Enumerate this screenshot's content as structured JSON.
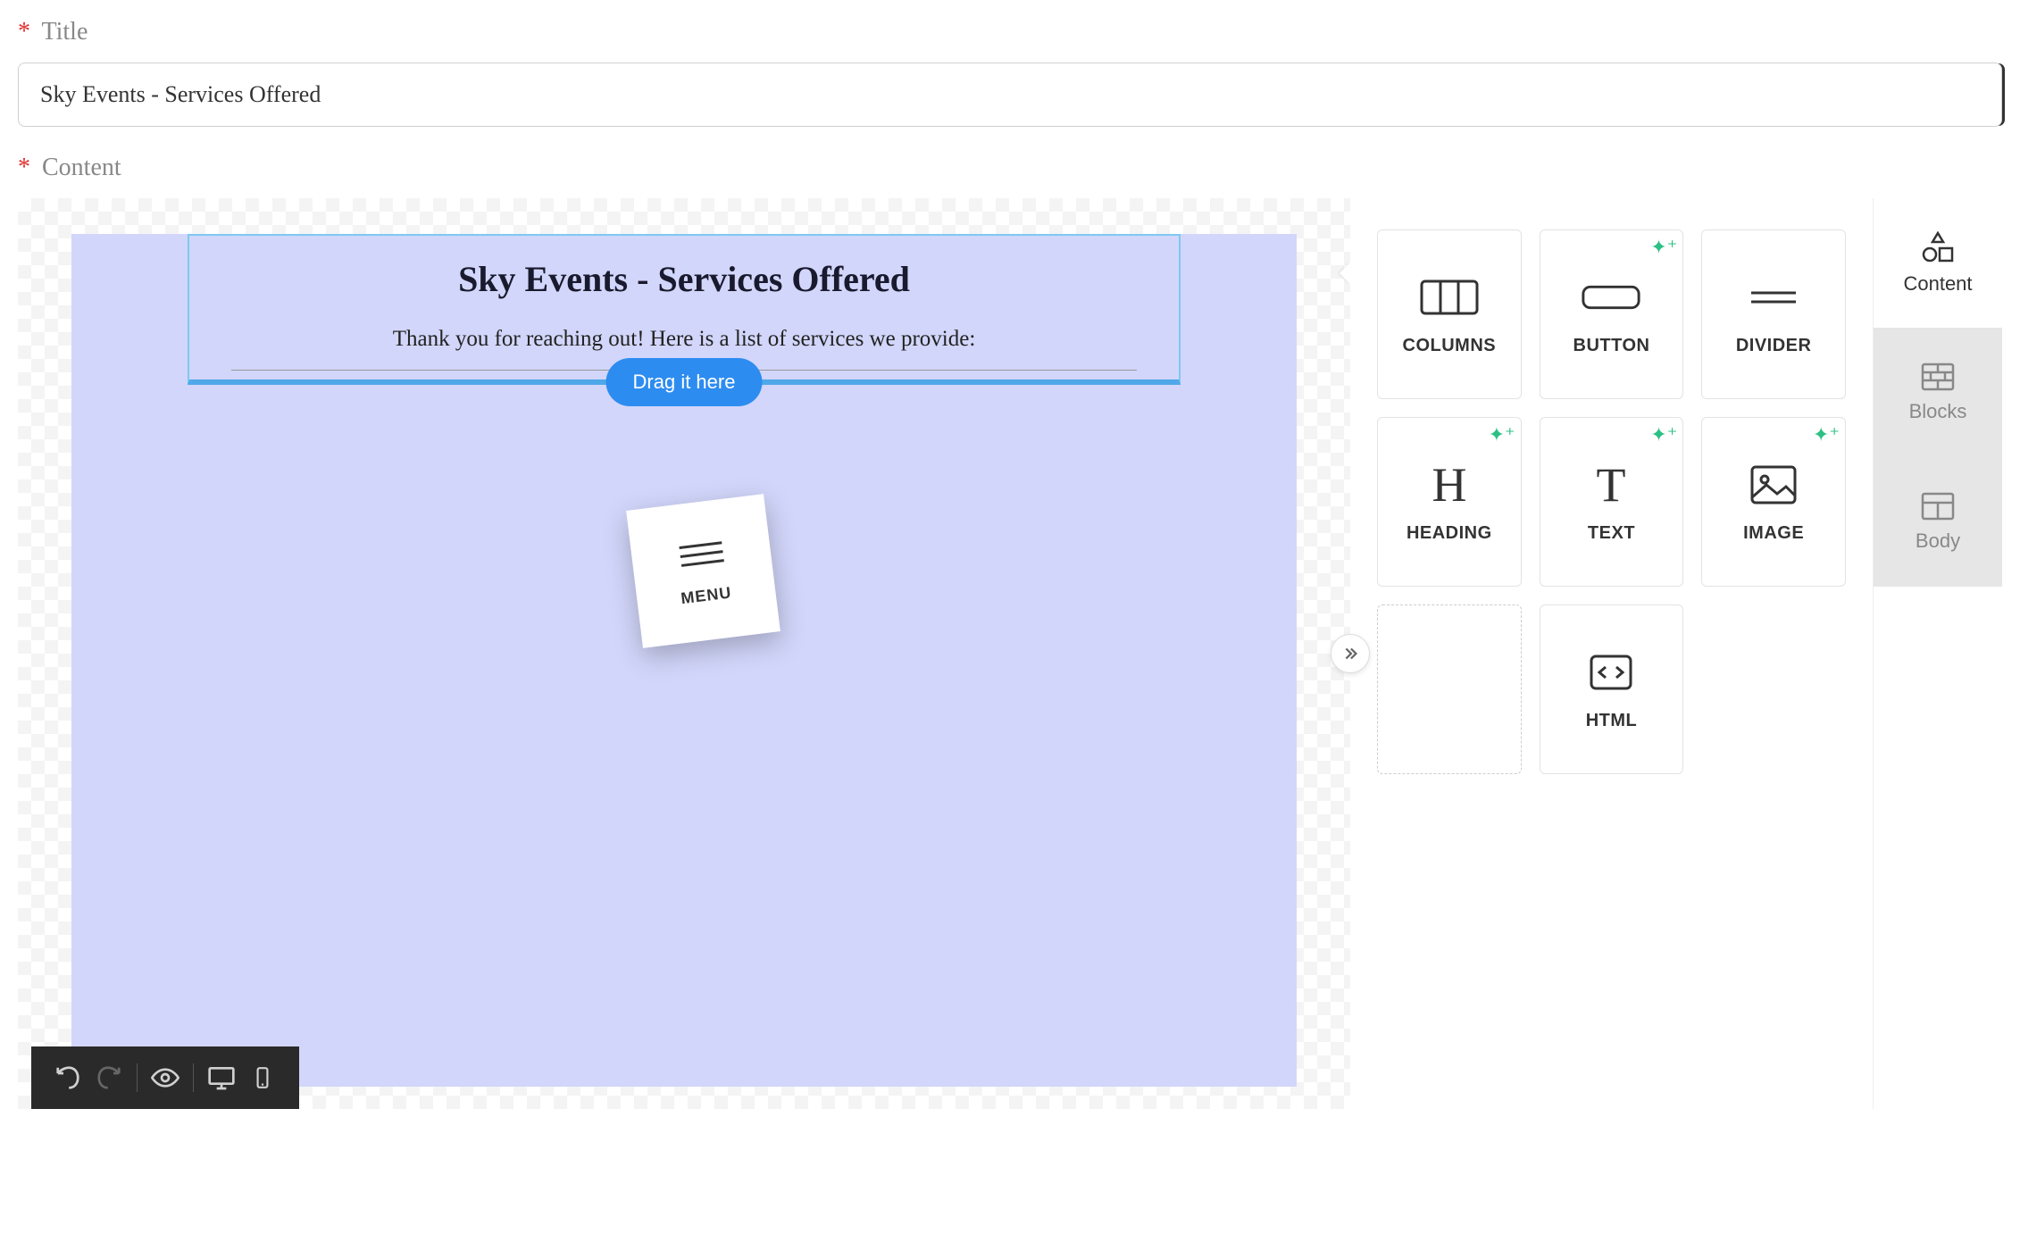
{
  "form": {
    "title_label": "Title",
    "title_value": "Sky Events - Services Offered",
    "content_label": "Content"
  },
  "canvas": {
    "heading": "Sky Events - Services Offered",
    "text": "Thank you for reaching out! Here is a list of services we provide:",
    "drag_hint": "Drag it here"
  },
  "dragging_block": {
    "label": "MENU"
  },
  "blocks": {
    "columns": "COLUMNS",
    "button": "BUTTON",
    "divider": "DIVIDER",
    "heading": "HEADING",
    "text": "TEXT",
    "image": "IMAGE",
    "html": "HTML"
  },
  "tabs": {
    "content": "Content",
    "blocks": "Blocks",
    "body": "Body"
  }
}
